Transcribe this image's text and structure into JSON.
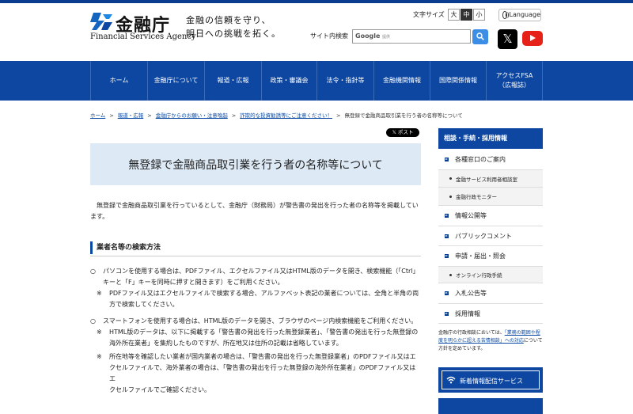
{
  "header": {
    "logo_ja": "金融庁",
    "logo_en": "Financial Services Agency",
    "tagline_line1": "金融の信頼を守り、",
    "tagline_line2": "明日への挑戦を拓く。",
    "font_size_label": "文字サイズ",
    "font_sizes": [
      "大",
      "中",
      "小"
    ],
    "language_label": "Language",
    "search_label": "サイト内検索",
    "search_google": "Google",
    "search_provided": "提供"
  },
  "nav": {
    "items": [
      "ホーム",
      "金融庁について",
      "報道・広報",
      "政策・審議会",
      "法令・指針等",
      "金融機関情報",
      "国際関係情報",
      "アクセスFSA（広報誌）"
    ]
  },
  "breadcrumb": {
    "items": [
      "ホーム",
      "報道・広報",
      "金融庁からのお願い・注意喚起",
      "詐欺的な投資勧誘等にご注意ください！"
    ],
    "current": "無登録で金融商品取引業を行う者の名称等について"
  },
  "share": {
    "x_post": "ポスト"
  },
  "main": {
    "title": "無登録で金融商品取引業を行う者の名称等について",
    "intro": "無登録で金融商品取引業を行っているとして、金融庁（財務局）が警告書の発出を行った者の名称等を掲載しています。",
    "section_title": "業者名等の検索方法",
    "bullet_mark": "○",
    "note_mark": "※",
    "bullet1_line1": "パソコンを使用する場合は、PDFファイル、エクセルファイル又はHTML版のデータを開き、検索機能（「Ctrl」",
    "bullet1_line2": "キーと「F」キーを同時に押すと開きます）をご利用ください。",
    "note1_line1": "PDFファイル又はエクセルファイルで検索する場合、アルファベット表記の業者については、全角と半角の両",
    "note1_line2": "方で検索してください。",
    "bullet2": "スマートフォンを使用する場合は、HTML版のデータを開き、ブラウザのページ内検索機能をご利用ください。",
    "note2_line1": "HTML版のデータは、以下に掲載する「警告書の発出を行った無登録業者」、「警告書の発出を行った無登録の",
    "note2_line2": "海外所在業者」を集約したものですが、所在地又は住所の記載は省略しています。",
    "note3_line1": "所在地等を確認したい業者が国内業者の場合は、「警告書の発出を行った無登録業者」のPDFファイル又はエ",
    "note3_line2": "クセルファイルで、海外業者の場合は、「警告書の発出を行った無登録の海外所在業者」のPDFファイル又はエ",
    "note3_line3": "クセルファイルでご確認ください。"
  },
  "sidebar": {
    "heading": "相談・手続・採用情報",
    "items": [
      {
        "label": "各種窓口のご案内",
        "type": "main"
      },
      {
        "label": "金融サービス利用者相談室",
        "type": "sub"
      },
      {
        "label": "金融行政モニター",
        "type": "sub"
      },
      {
        "label": "情報公開等",
        "type": "main"
      },
      {
        "label": "パブリックコメント",
        "type": "main"
      },
      {
        "label": "申請・届出・照会",
        "type": "main"
      },
      {
        "label": "オンライン行政手続",
        "type": "sub"
      },
      {
        "label": "入札公告等",
        "type": "main"
      },
      {
        "label": "採用情報",
        "type": "main"
      }
    ],
    "note_prefix": "金融庁の行政相談においては、",
    "note_link": "「業務の範囲や程度を明らかに超える苦情相談」への対応",
    "note_suffix": "について方針を定めています。",
    "banner": "新着情報配信サービス"
  },
  "colors": {
    "brand_blue": "#0d47a1",
    "title_bg": "#ddeaf6",
    "link": "#0b4aa2"
  }
}
